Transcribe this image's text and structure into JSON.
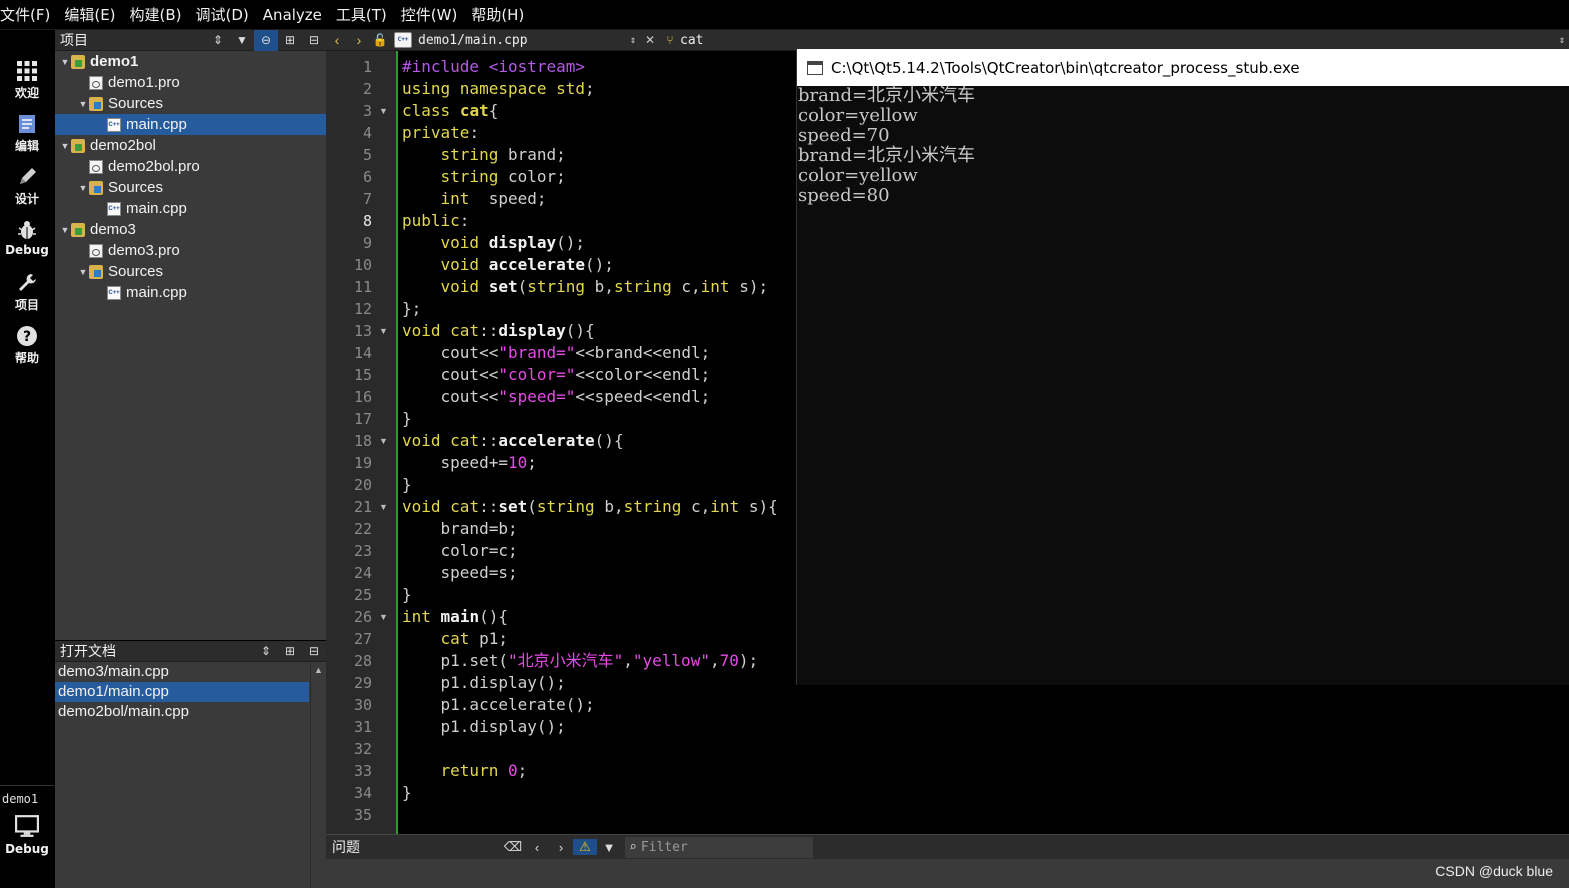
{
  "menu": [
    "文件(F)",
    "编辑(E)",
    "构建(B)",
    "调试(D)",
    "Analyze",
    "工具(T)",
    "控件(W)",
    "帮助(H)"
  ],
  "modes": [
    {
      "label": "欢迎",
      "icon": "grid-icon"
    },
    {
      "label": "编辑",
      "icon": "document-icon"
    },
    {
      "label": "设计",
      "icon": "pencil-icon"
    },
    {
      "label": "Debug",
      "icon": "bug-icon"
    },
    {
      "label": "项目",
      "icon": "wrench-icon"
    },
    {
      "label": "帮助",
      "icon": "help-icon"
    }
  ],
  "kit": {
    "name": "demo1",
    "mode": "Debug"
  },
  "project_pane": {
    "title": "项目",
    "tree": [
      {
        "label": "demo1",
        "type": "project",
        "depth": 0,
        "expanded": true,
        "bold": true
      },
      {
        "label": "demo1.pro",
        "type": "pro",
        "depth": 1
      },
      {
        "label": "Sources",
        "type": "folder",
        "depth": 1,
        "expanded": true
      },
      {
        "label": "main.cpp",
        "type": "cpp",
        "depth": 2,
        "selected": true
      },
      {
        "label": "demo2bol",
        "type": "project",
        "depth": 0,
        "expanded": true
      },
      {
        "label": "demo2bol.pro",
        "type": "pro",
        "depth": 1
      },
      {
        "label": "Sources",
        "type": "folder",
        "depth": 1,
        "expanded": true
      },
      {
        "label": "main.cpp",
        "type": "cpp",
        "depth": 2
      },
      {
        "label": "demo3",
        "type": "project",
        "depth": 0,
        "expanded": true
      },
      {
        "label": "demo3.pro",
        "type": "pro",
        "depth": 1
      },
      {
        "label": "Sources",
        "type": "folder",
        "depth": 1,
        "expanded": true
      },
      {
        "label": "main.cpp",
        "type": "cpp",
        "depth": 2
      }
    ]
  },
  "docs_pane": {
    "title": "打开文档",
    "docs": [
      {
        "label": "demo3/main.cpp"
      },
      {
        "label": "demo1/main.cpp",
        "selected": true
      },
      {
        "label": "demo2bol/main.cpp"
      }
    ]
  },
  "editor_toolbar": {
    "file": "demo1/main.cpp",
    "symbol": "cat"
  },
  "editor": {
    "current_line": 8,
    "folds": [
      3,
      13,
      18,
      21,
      26
    ],
    "lines": [
      [
        [
          "pp",
          "#include <iostream>"
        ]
      ],
      [
        [
          "k",
          "using namespace"
        ],
        [
          "pl",
          " "
        ],
        [
          "k",
          "std"
        ],
        [
          "pl",
          ";"
        ]
      ],
      [
        [
          "k",
          "class"
        ],
        [
          "pl",
          " "
        ],
        [
          "kb",
          "cat"
        ],
        [
          "pl",
          "{"
        ]
      ],
      [
        [
          "k",
          "private"
        ],
        [
          "pl",
          ":"
        ]
      ],
      [
        [
          "pl",
          "    "
        ],
        [
          "k",
          "string"
        ],
        [
          "pl",
          " brand;"
        ]
      ],
      [
        [
          "pl",
          "    "
        ],
        [
          "k",
          "string"
        ],
        [
          "pl",
          " color;"
        ]
      ],
      [
        [
          "pl",
          "    "
        ],
        [
          "k",
          "int"
        ],
        [
          "pl",
          "  speed;"
        ]
      ],
      [
        [
          "k",
          "public"
        ],
        [
          "pl",
          ":"
        ]
      ],
      [
        [
          "pl",
          "    "
        ],
        [
          "k",
          "void"
        ],
        [
          "pl",
          " "
        ],
        [
          "t",
          "display"
        ],
        [
          "pl",
          "();"
        ]
      ],
      [
        [
          "pl",
          "    "
        ],
        [
          "k",
          "void"
        ],
        [
          "pl",
          " "
        ],
        [
          "t",
          "accelerate"
        ],
        [
          "pl",
          "();"
        ]
      ],
      [
        [
          "pl",
          "    "
        ],
        [
          "k",
          "void"
        ],
        [
          "pl",
          " "
        ],
        [
          "t",
          "set"
        ],
        [
          "pl",
          "("
        ],
        [
          "k",
          "string"
        ],
        [
          "pl",
          " b,"
        ],
        [
          "k",
          "string"
        ],
        [
          "pl",
          " c,"
        ],
        [
          "k",
          "int"
        ],
        [
          "pl",
          " s);"
        ]
      ],
      [
        [
          "pl",
          "};"
        ]
      ],
      [
        [
          "k",
          "void"
        ],
        [
          "pl",
          " "
        ],
        [
          "k",
          "cat"
        ],
        [
          "pl",
          "::"
        ],
        [
          "t",
          "display"
        ],
        [
          "pl",
          "(){"
        ]
      ],
      [
        [
          "pl",
          "    cout<<"
        ],
        [
          "s",
          "\"brand=\""
        ],
        [
          "pl",
          "<<brand<<endl;"
        ]
      ],
      [
        [
          "pl",
          "    cout<<"
        ],
        [
          "s",
          "\"color=\""
        ],
        [
          "pl",
          "<<color<<endl;"
        ]
      ],
      [
        [
          "pl",
          "    cout<<"
        ],
        [
          "s",
          "\"speed=\""
        ],
        [
          "pl",
          "<<speed<<endl;"
        ]
      ],
      [
        [
          "pl",
          "}"
        ]
      ],
      [
        [
          "k",
          "void"
        ],
        [
          "pl",
          " "
        ],
        [
          "k",
          "cat"
        ],
        [
          "pl",
          "::"
        ],
        [
          "t",
          "accelerate"
        ],
        [
          "pl",
          "(){"
        ]
      ],
      [
        [
          "pl",
          "    speed+="
        ],
        [
          "n",
          "10"
        ],
        [
          "pl",
          ";"
        ]
      ],
      [
        [
          "pl",
          "}"
        ]
      ],
      [
        [
          "k",
          "void"
        ],
        [
          "pl",
          " "
        ],
        [
          "k",
          "cat"
        ],
        [
          "pl",
          "::"
        ],
        [
          "t",
          "set"
        ],
        [
          "pl",
          "("
        ],
        [
          "k",
          "string"
        ],
        [
          "pl",
          " b,"
        ],
        [
          "k",
          "string"
        ],
        [
          "pl",
          " c,"
        ],
        [
          "k",
          "int"
        ],
        [
          "pl",
          " s){"
        ]
      ],
      [
        [
          "pl",
          "    brand=b;"
        ]
      ],
      [
        [
          "pl",
          "    color=c;"
        ]
      ],
      [
        [
          "pl",
          "    speed=s;"
        ]
      ],
      [
        [
          "pl",
          "}"
        ]
      ],
      [
        [
          "k",
          "int"
        ],
        [
          "pl",
          " "
        ],
        [
          "t",
          "main"
        ],
        [
          "pl",
          "(){"
        ]
      ],
      [
        [
          "pl",
          "    "
        ],
        [
          "k",
          "cat"
        ],
        [
          "pl",
          " p1;"
        ]
      ],
      [
        [
          "pl",
          "    p1.set("
        ],
        [
          "s",
          "\"北京小米汽车\""
        ],
        [
          "pl",
          ","
        ],
        [
          "s",
          "\"yellow\""
        ],
        [
          "pl",
          ","
        ],
        [
          "n",
          "70"
        ],
        [
          "pl",
          ");"
        ]
      ],
      [
        [
          "pl",
          "    p1.display();"
        ]
      ],
      [
        [
          "pl",
          "    p1.accelerate();"
        ]
      ],
      [
        [
          "pl",
          "    p1.display();"
        ]
      ],
      [
        [
          "pl",
          ""
        ]
      ],
      [
        [
          "pl",
          "    "
        ],
        [
          "k",
          "return"
        ],
        [
          "pl",
          " "
        ],
        [
          "n",
          "0"
        ],
        [
          "pl",
          ";"
        ]
      ],
      [
        [
          "pl",
          "}"
        ]
      ],
      [
        [
          "pl",
          ""
        ]
      ]
    ]
  },
  "console": {
    "title": "C:\\Qt\\Qt5.14.2\\Tools\\QtCreator\\bin\\qtcreator_process_stub.exe",
    "output": [
      "brand=北京小米汽车",
      "color=yellow",
      "speed=70",
      "brand=北京小米汽车",
      "color=yellow",
      "speed=80"
    ]
  },
  "issues": {
    "title": "问题",
    "filter_placeholder": "Filter"
  },
  "watermark": "CSDN @duck blue"
}
